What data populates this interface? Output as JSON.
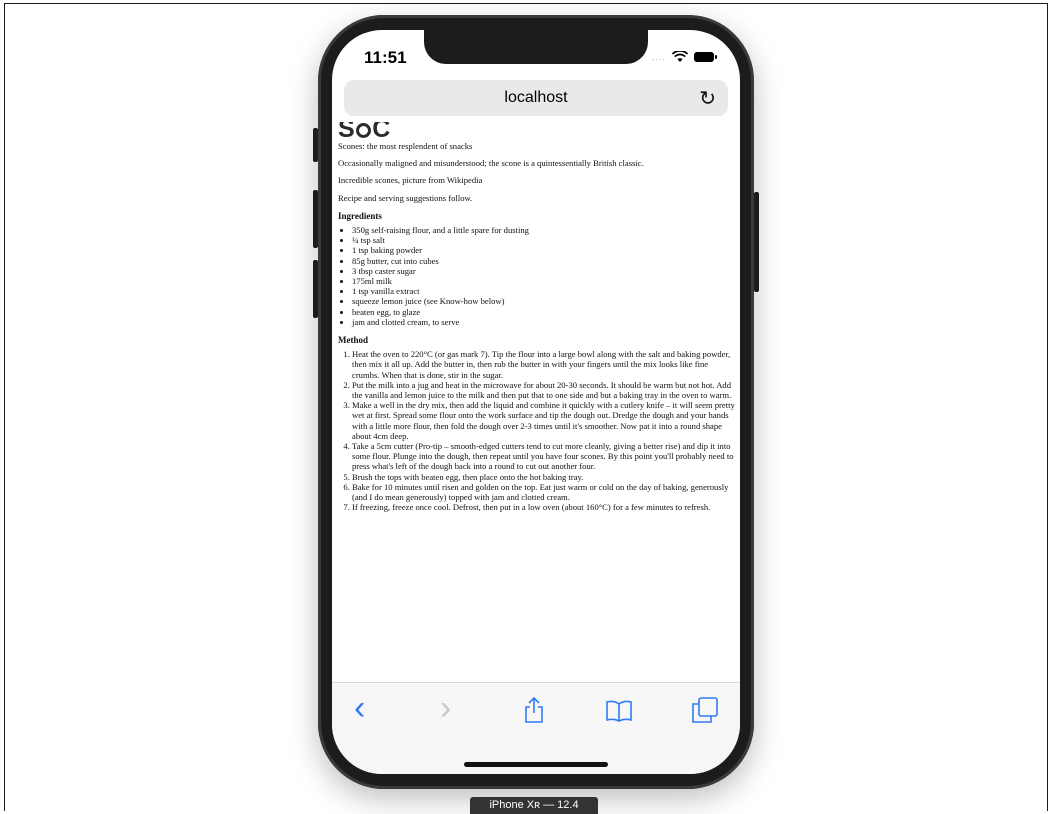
{
  "status": {
    "time": "11:51"
  },
  "browser": {
    "url": "localhost",
    "reload_icon": "reload-icon"
  },
  "page": {
    "logo_left": "S",
    "logo_right": "C",
    "paragraphs": [
      "Scones: the most resplendent of snacks",
      "Occasionally maligned and misunderstood; the scone is a quintessentially British classic.",
      "Incredible scones, picture from Wikipedia",
      "Recipe and serving suggestions follow."
    ],
    "ingredients_heading": "Ingredients",
    "ingredients": [
      "350g self-raising flour, and a little spare for dusting",
      "¼ tsp salt",
      "1 tsp baking powder",
      "85g butter, cut into cubes",
      "3 tbsp caster sugar",
      "175ml milk",
      "1 tsp vanilla extract",
      "squeeze lemon juice (see Know-how below)",
      "beaten egg, to glaze",
      "jam and clotted cream, to serve"
    ],
    "method_heading": "Method",
    "method": [
      "Heat the oven to 220°C (or gas mark 7). Tip the flour into a large bowl along with the salt and baking powder, then mix it all up. Add the butter in, then rub the butter in with your fingers until the mix looks like fine crumbs. When that is done, stir in the sugar.",
      "Put the milk into a jug and heat in the microwave for about 20-30 seconds. It should be warm but not hot. Add the vanilla and lemon juice to the milk and then put that to one side and but a baking tray in the oven to warm.",
      "Make a well in the dry mix, then add the liquid and combine it quickly with a cutlery knife – it will seem pretty wet at first. Spread some flour onto the work surface and tip the dough out. Dredge the dough and your hands with a little more flour, then fold the dough over 2-3 times until it's smoother. Now pat it into a round shape about 4cm deep.",
      "Take a 5cm cutter (Pro-tip – smooth-edged cutters tend to cut more cleanly, giving a better rise) and dip it into some flour. Plunge into the dough, then repeat until you have four scones. By this point you'll probably need to press what's left of the dough back into a round to cut out another four.",
      "Brush the tops with beaten egg, then place onto the hot baking tray.",
      "Bake for 10 minutes until risen and golden on the top. Eat just warm or cold on the day of baking, generously (and I do mean generously) topped with jam and clotted cream.",
      "If freezing, freeze once cool. Defrost, then put in a low oven (about 160°C) for a few minutes to refresh."
    ]
  },
  "toolbar": {
    "back": "‹",
    "forward": "›",
    "share": "⇧",
    "bookmarks": "🕮",
    "tabs": "❐"
  },
  "device_label": "iPhone Xʀ — 12.4"
}
